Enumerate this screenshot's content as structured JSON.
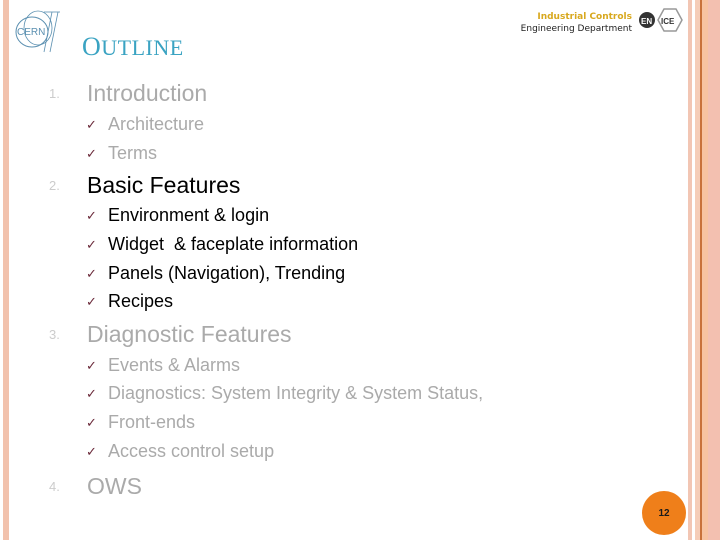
{
  "header": {
    "title_first": "O",
    "title_rest": "UTLINE",
    "logo_text": "CERN",
    "department_line1": "Industrial Controls",
    "department_line2": "Engineering Department",
    "group_logo_left": "EN",
    "group_logo_right": "ICE"
  },
  "outline": [
    {
      "number": "1.",
      "label": "Introduction",
      "active": false,
      "items": [
        "Architecture",
        "Terms"
      ]
    },
    {
      "number": "2.",
      "label": "Basic Features",
      "active": true,
      "items": [
        "Environment & login",
        "Widget  & faceplate information",
        "Panels (Navigation), Trending",
        "Recipes"
      ]
    },
    {
      "number": "3.",
      "label": "Diagnostic Features",
      "active": false,
      "items": [
        "Events & Alarms",
        "Diagnostics: System Integrity & System Status,",
        "Front-ends",
        "Access control setup"
      ]
    },
    {
      "number": "4.",
      "label": "OWS",
      "active": false,
      "items": []
    }
  ],
  "check_glyph": "✓",
  "page_number": "12",
  "colors": {
    "title": "#3aa3c2",
    "badge": "#ef7f1a",
    "active_text": "#000000",
    "inactive_text": "#aaaaaa",
    "check": "#6b2a3a"
  }
}
